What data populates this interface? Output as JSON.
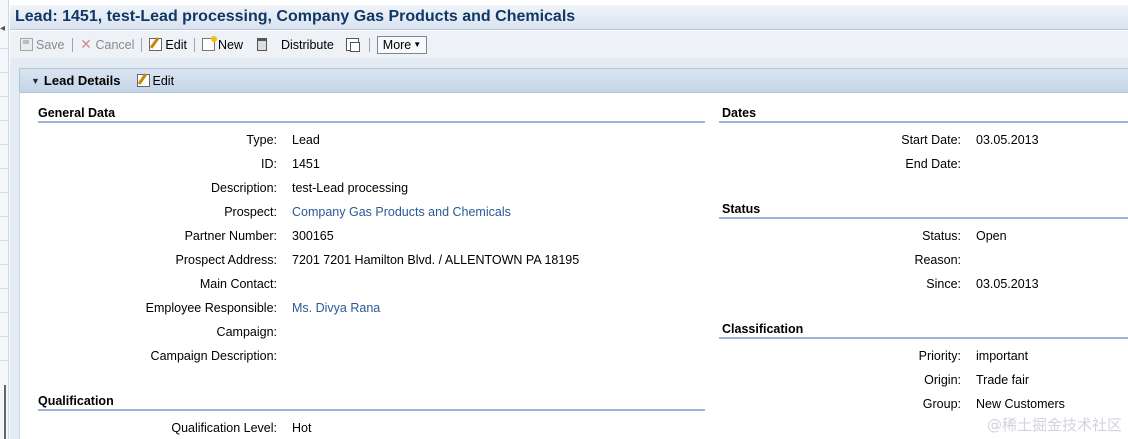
{
  "window": {
    "title": "Lead: 1451, test-Lead processing, Company Gas Products and Chemicals"
  },
  "toolbar": {
    "save_label": "Save",
    "cancel_label": "Cancel",
    "edit_label": "Edit",
    "new_label": "New",
    "distribute_label": "Distribute",
    "more_label": "More"
  },
  "panel": {
    "title": "Lead Details",
    "edit_label": "Edit"
  },
  "general": {
    "title": "General Data",
    "fields": [
      {
        "label": "Type:",
        "value": "Lead"
      },
      {
        "label": "ID:",
        "value": "1451"
      },
      {
        "label": "Description:",
        "value": "test-Lead processing"
      },
      {
        "label": "Prospect:",
        "value": "Company Gas Products and Chemicals"
      },
      {
        "label": "Partner Number:",
        "value": "300165"
      },
      {
        "label": "Prospect Address:",
        "value": "7201 7201 Hamilton Blvd. / ALLENTOWN PA 18195"
      },
      {
        "label": "Main Contact:",
        "value": ""
      },
      {
        "label": "Employee Responsible:",
        "value": "Ms. Divya Rana"
      },
      {
        "label": "Campaign:",
        "value": ""
      },
      {
        "label": "Campaign Description:",
        "value": ""
      }
    ]
  },
  "qualification": {
    "title": "Qualification",
    "fields": [
      {
        "label": "Qualification Level:",
        "value": "Hot"
      }
    ]
  },
  "dates": {
    "title": "Dates",
    "fields": [
      {
        "label": "Start Date:",
        "value": "03.05.2013"
      },
      {
        "label": "End Date:",
        "value": ""
      }
    ]
  },
  "status": {
    "title": "Status",
    "fields": [
      {
        "label": "Status:",
        "value": "Open"
      },
      {
        "label": "Reason:",
        "value": ""
      },
      {
        "label": "Since:",
        "value": "03.05.2013"
      }
    ]
  },
  "classification": {
    "title": "Classification",
    "fields": [
      {
        "label": "Priority:",
        "value": "important"
      },
      {
        "label": "Origin:",
        "value": "Trade fair"
      },
      {
        "label": "Group:",
        "value": "New Customers"
      }
    ]
  },
  "watermark": "@稀土掘金技术社区",
  "colors": {
    "title_text": "#113766",
    "link": "#2a5a96",
    "section_rule": "#9fb6d2",
    "panel_header": "#c4d4e8"
  }
}
